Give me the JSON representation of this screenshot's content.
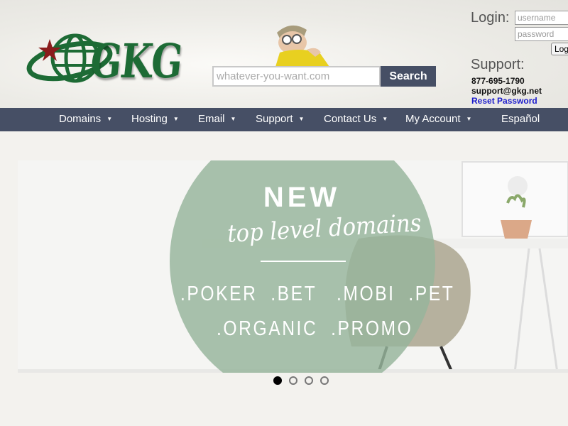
{
  "logo": {
    "text": "GKG"
  },
  "search": {
    "placeholder": "whatever-you-want.com",
    "button_label": "Search"
  },
  "login": {
    "label": "Login:",
    "username_placeholder": "username",
    "password_placeholder": "password",
    "button_label": "Log"
  },
  "support": {
    "label": "Support:",
    "phone": "877-695-1790",
    "email": "support@gkg.net",
    "reset_link": "Reset Password"
  },
  "nav": {
    "items": [
      {
        "label": "Domains",
        "caret": "▼"
      },
      {
        "label": "Hosting",
        "caret": "▼"
      },
      {
        "label": "Email",
        "caret": "▼"
      },
      {
        "label": "Support",
        "caret": "▼"
      },
      {
        "label": "Contact Us",
        "caret": "▼"
      },
      {
        "label": "My Account",
        "caret": "▼"
      },
      {
        "label": "Español"
      }
    ]
  },
  "banner": {
    "headline": "NEW",
    "subheadline": "top level domains",
    "tlds_row1": ".POKER  .BET   .MOBI  .PET",
    "tlds_row2": ".ORGANIC  .PROMO",
    "accent_color": "#96b49b"
  },
  "carousel": {
    "total": 4,
    "active_index": 0
  },
  "colors": {
    "nav": "#464f65",
    "logo_green": "#1d6b35",
    "link": "#1a1acc"
  }
}
